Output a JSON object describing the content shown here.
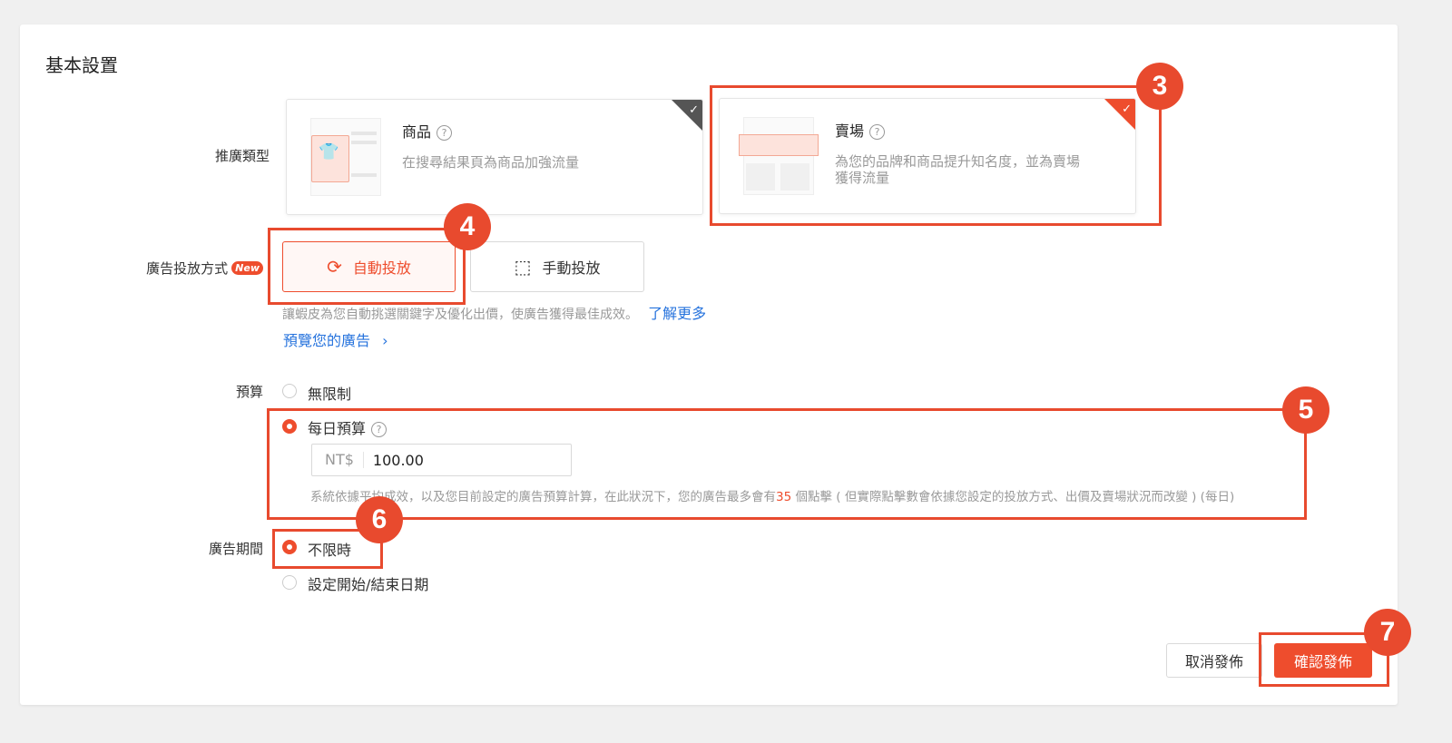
{
  "section": {
    "title": "基本設置"
  },
  "promo_type": {
    "label": "推廣類型",
    "cards": [
      {
        "title": "商品",
        "desc": "在搜尋結果頁為商品加強流量",
        "selected": false
      },
      {
        "title": "賣場",
        "desc_line1": "為您的品牌和商品提升知名度，並為賣場",
        "desc_line2": "獲得流量",
        "selected": true
      }
    ]
  },
  "placement": {
    "label": "廣告投放方式",
    "new_badge": "New",
    "options": [
      {
        "label": "自動投放",
        "icon": "refresh-icon",
        "selected": true
      },
      {
        "label": "手動投放",
        "icon": "cursor-select-icon",
        "selected": false
      }
    ],
    "hint": "讓蝦皮為您自動挑選關鍵字及優化出價，使廣告獲得最佳成效。",
    "learn_more": "了解更多",
    "preview_link": "預覽您的廣告"
  },
  "budget": {
    "label": "預算",
    "unlimited_label": "無限制",
    "daily_label": "每日預算",
    "selected": "daily",
    "currency": "NT$",
    "amount": "100.00",
    "note_before": "系統依據平均成效，以及您目前設定的廣告預算計算，在此狀況下，您的廣告最多會有",
    "note_clicks": "35",
    "note_after": " 個點擊 ( 但實際點擊數會依據您設定的投放方式、出價及賣場狀況而改變 ) (每日)"
  },
  "period": {
    "label": "廣告期間",
    "options": [
      {
        "label": "不限時",
        "selected": true
      },
      {
        "label": "設定開始/結束日期",
        "selected": false
      }
    ]
  },
  "actions": {
    "cancel": "取消發佈",
    "confirm": "確認發佈"
  },
  "annotations": [
    "3",
    "4",
    "5",
    "6",
    "7"
  ],
  "colors": {
    "accent": "#ee4d2d",
    "annotation": "#e84a2e",
    "link": "#2673dd"
  }
}
